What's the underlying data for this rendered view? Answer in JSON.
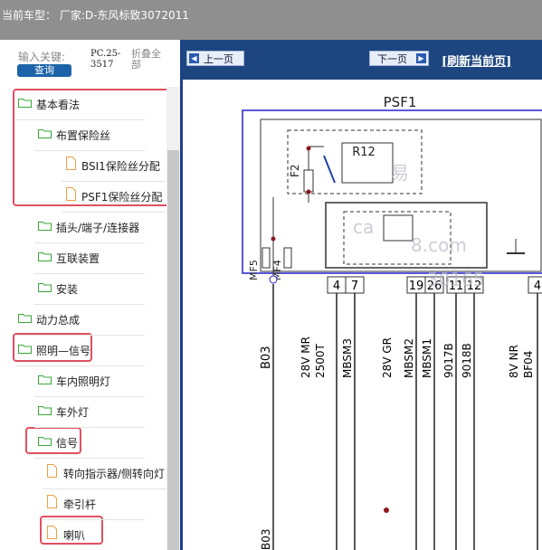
{
  "header": {
    "model_label": "当前车型： 厂家:D-东风标致3072011"
  },
  "search": {
    "keyword_label": "输入关键:",
    "query_button": "查询",
    "pc_code": "PC.25-3517",
    "fold_all": "折叠全部"
  },
  "tree": [
    {
      "label": "基本看法",
      "icon": "folder-open-icon"
    },
    {
      "label": "布置保险丝",
      "icon": "folder-open-icon"
    },
    {
      "label": "BSI1保险丝分配",
      "icon": "file-icon"
    },
    {
      "label": "PSF1保险丝分配",
      "icon": "file-icon"
    },
    {
      "label": "插头/端子/连接器",
      "icon": "folder-open-icon"
    },
    {
      "label": "互联装置",
      "icon": "folder-open-icon"
    },
    {
      "label": "安装",
      "icon": "folder-open-icon"
    },
    {
      "label": "动力总成",
      "icon": "folder-open-icon"
    },
    {
      "label": "照明—信号",
      "icon": "folder-open-icon"
    },
    {
      "label": "车内照明灯",
      "icon": "folder-open-icon"
    },
    {
      "label": "车外灯",
      "icon": "folder-open-icon"
    },
    {
      "label": "信号",
      "icon": "folder-open-icon"
    },
    {
      "label": "转向指示器/侧转向灯",
      "icon": "file-icon"
    },
    {
      "label": "牵引杆",
      "icon": "file-icon"
    },
    {
      "label": "喇叭",
      "icon": "file-icon"
    }
  ],
  "nav": {
    "prev": "上一页",
    "next": "下一页",
    "refresh": "[刷新当前页]"
  },
  "diagram": {
    "title": "PSF1",
    "relay": "R12",
    "fuse_f2": "F2",
    "fuse_mf5": "MF5",
    "fuse_mf4": "MF4",
    "pins": [
      "4",
      "7",
      "19",
      "26",
      "11",
      "12",
      "4"
    ],
    "wire_labels": [
      "B03",
      "28V MR",
      "2500T",
      "MBSM3",
      "28V GR",
      "MBSM2",
      "MBSM1",
      "9017B",
      "9018B",
      "8V NR",
      "BF04"
    ],
    "bottom_label": "B03",
    "watermark_lines": [
      "易",
      "ca",
      "8.com",
      "30165"
    ]
  },
  "colors": {
    "accent": "#1d4680",
    "highlight": "#e05060",
    "folder": "#3aa63a",
    "file": "#f0a040"
  }
}
